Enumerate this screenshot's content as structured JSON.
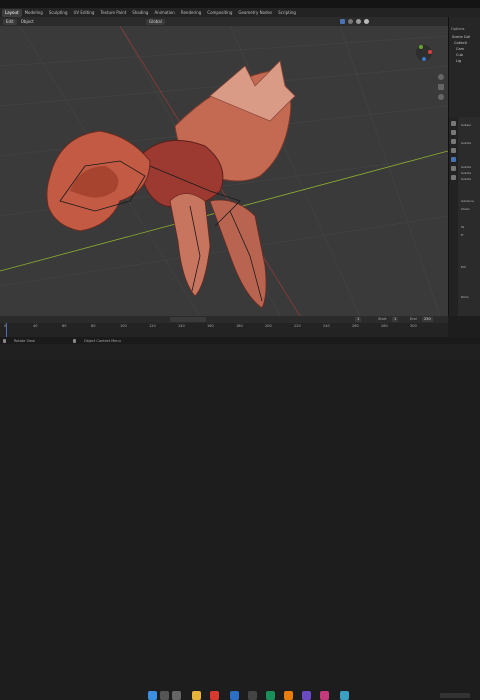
{
  "workspace_tabs": [
    "Layout",
    "Modeling",
    "Sculpting",
    "UV Editing",
    "Texture Paint",
    "Shading",
    "Animation",
    "Rendering",
    "Compositing",
    "Geometry Nodes",
    "Scripting"
  ],
  "active_tab_index": 0,
  "scene": {
    "label": "Scene"
  },
  "header": {
    "mode": "Edit",
    "object_menu": "Object",
    "orientation": "Global"
  },
  "outliner": {
    "options": "Options",
    "items": [
      "Scene Coll",
      "Collecti",
      "Cam",
      "Cub",
      "Lig"
    ]
  },
  "properties_labels": [
    "Subsur",
    "Subdiv",
    "Subdiv",
    "Subdiv",
    "Subdiv",
    "Advance",
    "Chain",
    "Ta",
    "Fr",
    "Ext",
    "Dims"
  ],
  "timeline": {
    "ticks": [
      "0",
      "40",
      "60",
      "80",
      "100",
      "120",
      "140",
      "160",
      "180",
      "200",
      "220",
      "240",
      "260",
      "280",
      "300"
    ],
    "current_frame": "1",
    "start_label": "Start",
    "start_value": "1",
    "end_label": "End",
    "end_value": "250"
  },
  "statusbar": {
    "rotate": "Rotate View",
    "context": "Object Context Menu"
  },
  "colors": {
    "accent": "#4772b3",
    "viewport_bg": "#3a3a3a",
    "grid": "#4a4a4a",
    "x_axis": "#a83a3a",
    "y_axis": "#8db030"
  }
}
